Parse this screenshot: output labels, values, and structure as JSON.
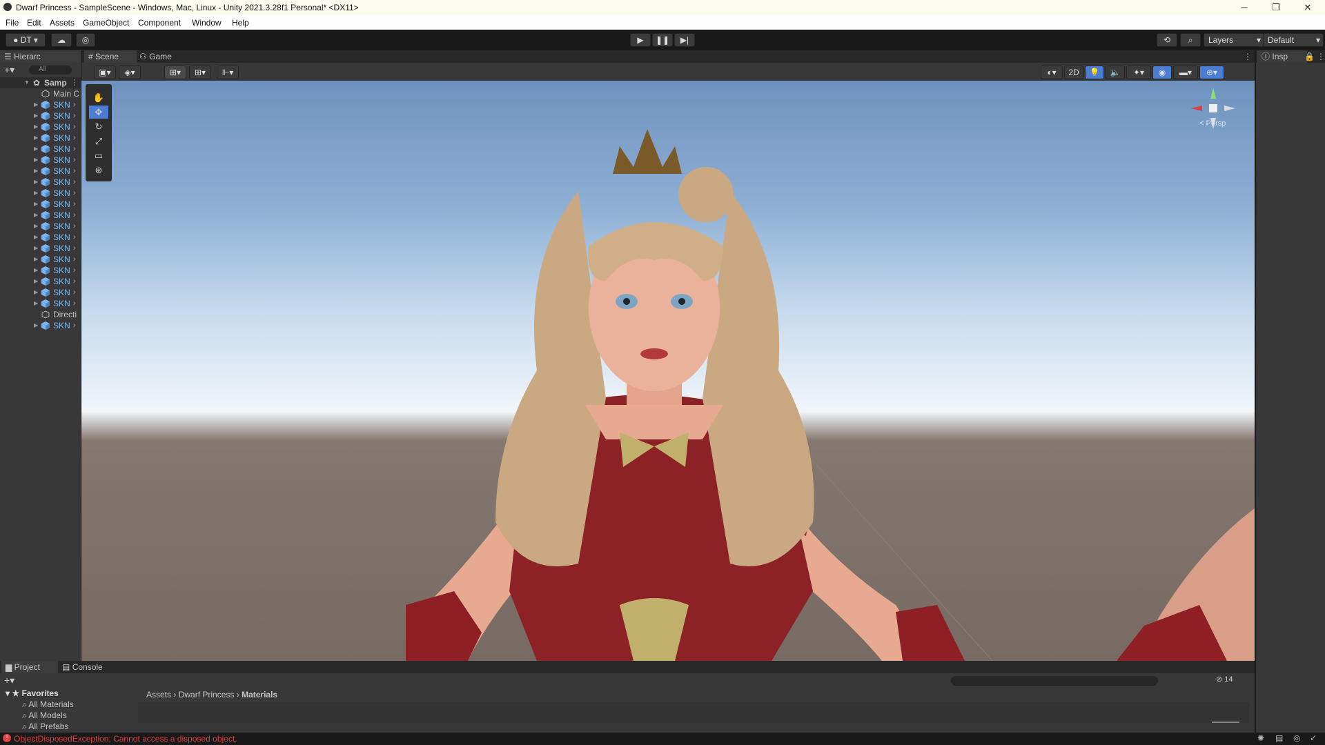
{
  "window": {
    "title": "Dwarf Princess - SampleScene - Windows, Mac, Linux - Unity 2021.3.28f1 Personal* <DX11>",
    "min_glyph": "─",
    "max_glyph": "❐",
    "close_glyph": "✕"
  },
  "menu": [
    "File",
    "Edit",
    "Assets",
    "GameObject",
    "Component",
    "Window",
    "Help"
  ],
  "toolbar": {
    "account_label": "DT",
    "layers_label": "Layers",
    "layout_label": "Default"
  },
  "hierarchy": {
    "tab_label": "Hierarc",
    "search_placeholder": "All",
    "scene_label": "Samp",
    "items": [
      {
        "label": "Main C",
        "type": "object"
      },
      {
        "label": "SKN",
        "type": "prefab"
      },
      {
        "label": "SKN",
        "type": "prefab"
      },
      {
        "label": "SKN",
        "type": "prefab"
      },
      {
        "label": "SKN",
        "type": "prefab"
      },
      {
        "label": "SKN",
        "type": "prefab"
      },
      {
        "label": "SKN",
        "type": "prefab"
      },
      {
        "label": "SKN",
        "type": "prefab"
      },
      {
        "label": "SKN",
        "type": "prefab"
      },
      {
        "label": "SKN",
        "type": "prefab"
      },
      {
        "label": "SKN",
        "type": "prefab"
      },
      {
        "label": "SKN",
        "type": "prefab"
      },
      {
        "label": "SKN",
        "type": "prefab"
      },
      {
        "label": "SKN",
        "type": "prefab"
      },
      {
        "label": "SKN",
        "type": "prefab"
      },
      {
        "label": "SKN",
        "type": "prefab"
      },
      {
        "label": "SKN",
        "type": "prefab"
      },
      {
        "label": "SKN",
        "type": "prefab"
      },
      {
        "label": "SKN",
        "type": "prefab"
      },
      {
        "label": "SKN",
        "type": "prefab"
      },
      {
        "label": "Directi",
        "type": "object"
      },
      {
        "label": "SKN",
        "type": "prefab"
      }
    ]
  },
  "scene": {
    "tabs": [
      "Scene",
      "Game"
    ],
    "mode_2d": "2D",
    "persp_label": "Persp"
  },
  "inspector": {
    "tab_label": "Insp"
  },
  "project": {
    "tabs": [
      "Project",
      "Console"
    ],
    "favorites_label": "Favorites",
    "favorites": [
      "All Materials",
      "All Models",
      "All Prefabs"
    ],
    "breadcrumb": [
      "Assets",
      "Dwarf Princess",
      "Materials"
    ],
    "hidden_count": "14"
  },
  "status": {
    "message": "ObjectDisposedException: Cannot access a disposed object."
  },
  "colors": {
    "accent_blue": "#4c7dd4",
    "error_red": "#e04040",
    "prefab_blue": "#7fb4ef"
  }
}
